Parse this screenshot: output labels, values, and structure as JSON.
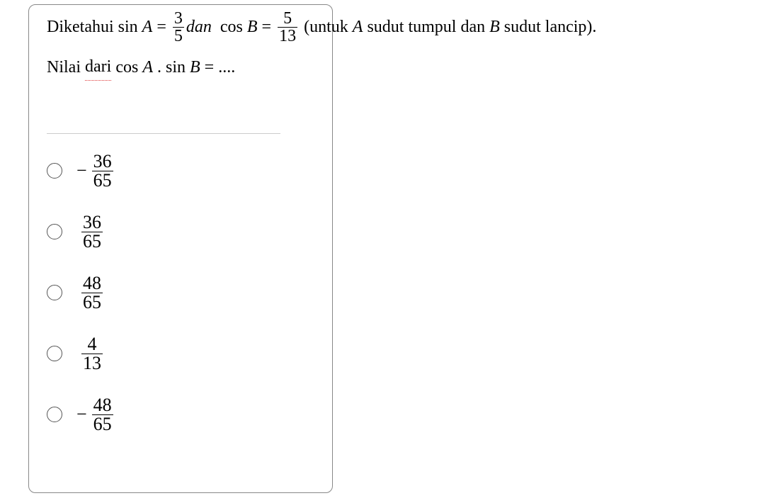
{
  "question": {
    "prefix": "Diketahui ",
    "sin": "sin",
    "A": "A",
    "eq": " = ",
    "frac1": {
      "num": "3",
      "den": "5"
    },
    "dan_it": "dan ",
    "cos": " cos",
    "B": "B",
    "frac2": {
      "num": "5",
      "den": "13"
    },
    "paren_open": " (untuk ",
    "paren_A": "A",
    "obtuse": " sudut tumpul dan ",
    "paren_B": "B",
    "acute": " sudut lancip).",
    "line2_prefix": "Nilai ",
    "dari": "dari",
    "cos2": " cos",
    "dot": " . ",
    "sin2": "sin",
    "tail": " = ...."
  },
  "options": [
    {
      "sign": "−",
      "num": "36",
      "den": "65"
    },
    {
      "sign": "",
      "num": "36",
      "den": "65"
    },
    {
      "sign": "",
      "num": "48",
      "den": "65"
    },
    {
      "sign": "",
      "num": "4",
      "den": "13"
    },
    {
      "sign": "−",
      "num": "48",
      "den": "65"
    }
  ]
}
